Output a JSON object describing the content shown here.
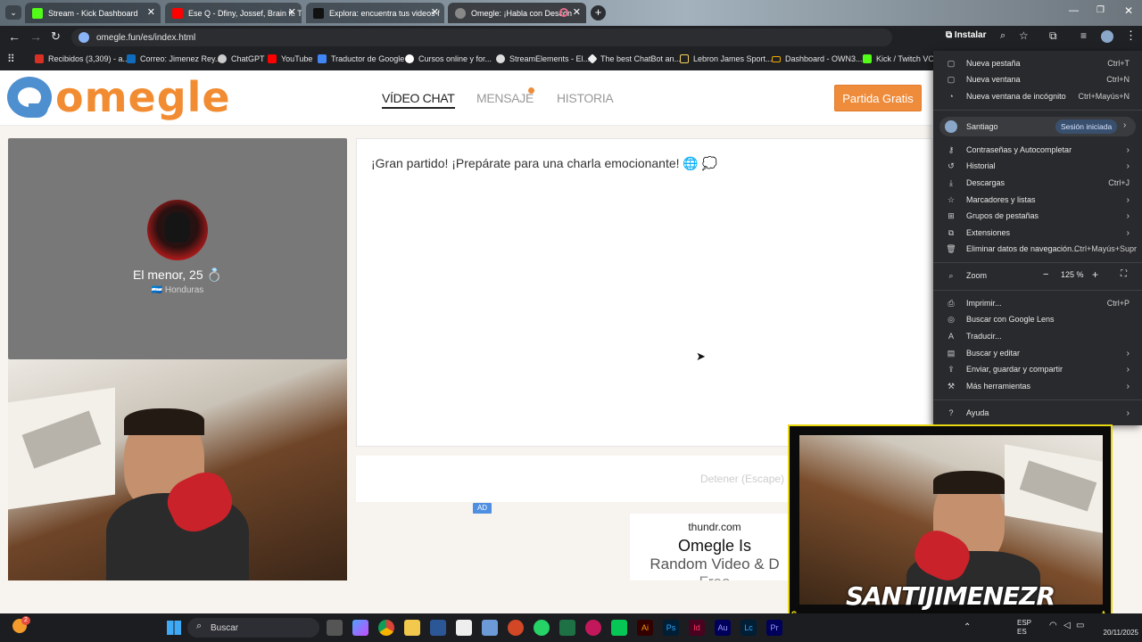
{
  "browser": {
    "tabs": [
      {
        "title": "Stream - Kick Dashboard",
        "color": "#53fc18"
      },
      {
        "title": "Ese Q - Dfiny, Jossef, Brain ft. Ta",
        "color": "#ff0000"
      },
      {
        "title": "Explora: encuentra tus videos f",
        "color": "#111111"
      },
      {
        "title": "Omegle: ¡Habla con Descon",
        "color": "#888888"
      }
    ],
    "url": "omegle.fun/es/index.html",
    "install_label": "Instalar",
    "bookmarks": [
      {
        "label": "Recibidos (3,309) - a...",
        "color": "#d93025"
      },
      {
        "label": "Correo: Jimenez Rey...",
        "color": "#0f6cbd"
      },
      {
        "label": "ChatGPT",
        "color": "#cccccc"
      },
      {
        "label": "YouTube",
        "color": "#ff0000"
      },
      {
        "label": "Traductor de Google",
        "color": "#4285f4"
      },
      {
        "label": "Cursos online y for...",
        "color": "#ffffff"
      },
      {
        "label": "StreamElements - El...",
        "color": "#ffffff"
      },
      {
        "label": "The best ChatBot an...",
        "color": "#ffffff"
      },
      {
        "label": "Lebron James Sport...",
        "color": "#f4d35e"
      },
      {
        "label": "Dashboard - OWN3...",
        "color": "#f2a900"
      },
      {
        "label": "Kick / Twitch VOD",
        "color": "#53fc18"
      }
    ]
  },
  "site": {
    "logo": "omegle",
    "nav": [
      "VÍDEO CHAT",
      "MENSAJE",
      "HISTORIA"
    ],
    "cta": "Partida Gratis",
    "stranger": {
      "name": "El menor, 25 💍",
      "country": "🇭🇳 Honduras"
    },
    "chat_message": "¡Gran partido! ¡Prepárate para una charla emocionante! 🌐 💭",
    "stop_label": "Detener (Escape)",
    "ad_badge": "AD",
    "ad": {
      "domain": "thundr.com",
      "headline": "Omegle Is",
      "sub": "Random Video & D",
      "sub2": "Free"
    }
  },
  "menu": {
    "items": [
      {
        "icon": "▢",
        "label": "Nueva pestaña",
        "shortcut": "Ctrl+T"
      },
      {
        "icon": "▢",
        "label": "Nueva ventana",
        "shortcut": "Ctrl+N"
      },
      {
        "icon": "◔",
        "label": "Nueva ventana de incógnito",
        "shortcut": "Ctrl+Mayús+N"
      }
    ],
    "profile": {
      "name": "Santiago",
      "badge": "Sesión iniciada"
    },
    "items2": [
      {
        "icon": "⚷",
        "label": "Contraseñas y Autocompletar",
        "shortcut": "›"
      },
      {
        "icon": "↺",
        "label": "Historial",
        "shortcut": "›"
      },
      {
        "icon": "⤓",
        "label": "Descargas",
        "shortcut": "Ctrl+J"
      },
      {
        "icon": "☆",
        "label": "Marcadores y listas",
        "shortcut": "›"
      },
      {
        "icon": "⊞",
        "label": "Grupos de pestañas",
        "shortcut": "›"
      },
      {
        "icon": "⧉",
        "label": "Extensiones",
        "shortcut": "›"
      },
      {
        "icon": "🗑",
        "label": "Eliminar datos de navegación...",
        "shortcut": "Ctrl+Mayús+Supr"
      }
    ],
    "zoom": {
      "label": "Zoom",
      "value": "125 %"
    },
    "items3": [
      {
        "icon": "⎙",
        "label": "Imprimir...",
        "shortcut": "Ctrl+P"
      },
      {
        "icon": "◎",
        "label": "Buscar con Google Lens",
        "shortcut": ""
      },
      {
        "icon": "A",
        "label": "Traducir...",
        "shortcut": ""
      },
      {
        "icon": "▤",
        "label": "Buscar y editar",
        "shortcut": "›"
      },
      {
        "icon": "⇪",
        "label": "Enviar, guardar y compartir",
        "shortcut": "›"
      },
      {
        "icon": "⚒",
        "label": "Más herramientas",
        "shortcut": "›"
      }
    ],
    "help": {
      "icon": "?",
      "label": "Ayuda",
      "shortcut": "›"
    }
  },
  "overlay": {
    "name": "SANTIJIMENEZR"
  },
  "taskbar": {
    "search": "Buscar",
    "lang": "ESP",
    "lang2": "ES",
    "date": "20/11/2025",
    "badge": "2"
  }
}
